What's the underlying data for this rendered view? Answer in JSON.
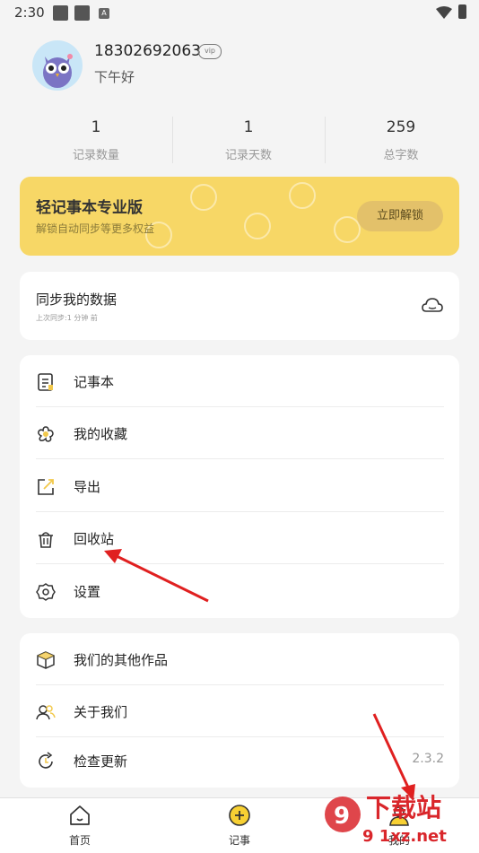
{
  "status_bar": {
    "time": "2:30",
    "small_icon": "A"
  },
  "profile": {
    "phone": "18302692063",
    "vip_badge": "vip",
    "greeting": "下午好"
  },
  "stats": [
    {
      "value": "1",
      "label": "记录数量"
    },
    {
      "value": "1",
      "label": "记录天数"
    },
    {
      "value": "259",
      "label": "总字数"
    }
  ],
  "pro_banner": {
    "title": "轻记事本专业版",
    "subtitle": "解锁自动同步等更多权益",
    "button": "立即解锁"
  },
  "sync_card": {
    "title": "同步我的数据",
    "last_sync": "上次同步:1 分钟 前"
  },
  "menu": [
    {
      "label": "记事本",
      "icon": "notebook-icon"
    },
    {
      "label": "我的收藏",
      "icon": "flower-icon"
    },
    {
      "label": "导出",
      "icon": "export-icon"
    },
    {
      "label": "回收站",
      "icon": "trash-icon"
    },
    {
      "label": "设置",
      "icon": "gear-icon"
    }
  ],
  "menu2": [
    {
      "label": "我们的其他作品",
      "icon": "box-icon"
    },
    {
      "label": "关于我们",
      "icon": "people-icon"
    },
    {
      "label": "检查更新",
      "icon": "refresh-icon",
      "value": "2.3.2"
    }
  ],
  "bottom_nav": [
    {
      "label": "首页",
      "icon": "home-icon"
    },
    {
      "label": "记事",
      "icon": "add-circle-icon"
    },
    {
      "label": "我的",
      "icon": "person-icon"
    }
  ],
  "watermark": {
    "brand": "下载站",
    "site": "9 1xz.net"
  },
  "colors": {
    "accent": "#f7d766",
    "background": "#f4f4f4",
    "arrow": "#e02020"
  }
}
